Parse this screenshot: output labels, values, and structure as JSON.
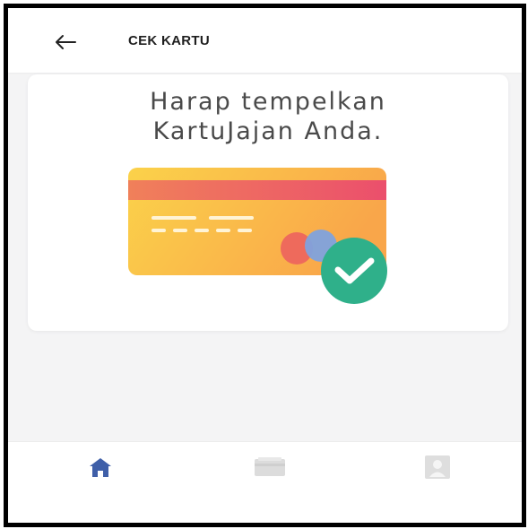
{
  "header": {
    "back_icon": "arrow-left-icon",
    "title": "CEK KARTU"
  },
  "card": {
    "instruction_line1": "Harap tempelkan",
    "instruction_line2": "KartuJajan Anda.",
    "illustration": "card-tap-check-illustration"
  },
  "bottom_nav": {
    "items": [
      {
        "icon": "home-icon",
        "active": true
      },
      {
        "icon": "card-icon",
        "active": false
      },
      {
        "icon": "profile-icon",
        "active": false
      }
    ]
  },
  "colors": {
    "accent_blue": "#3f5fa8",
    "inactive_icon": "#d9d9d9",
    "check_green": "#2fb08a",
    "card_band": "#e9546b"
  }
}
